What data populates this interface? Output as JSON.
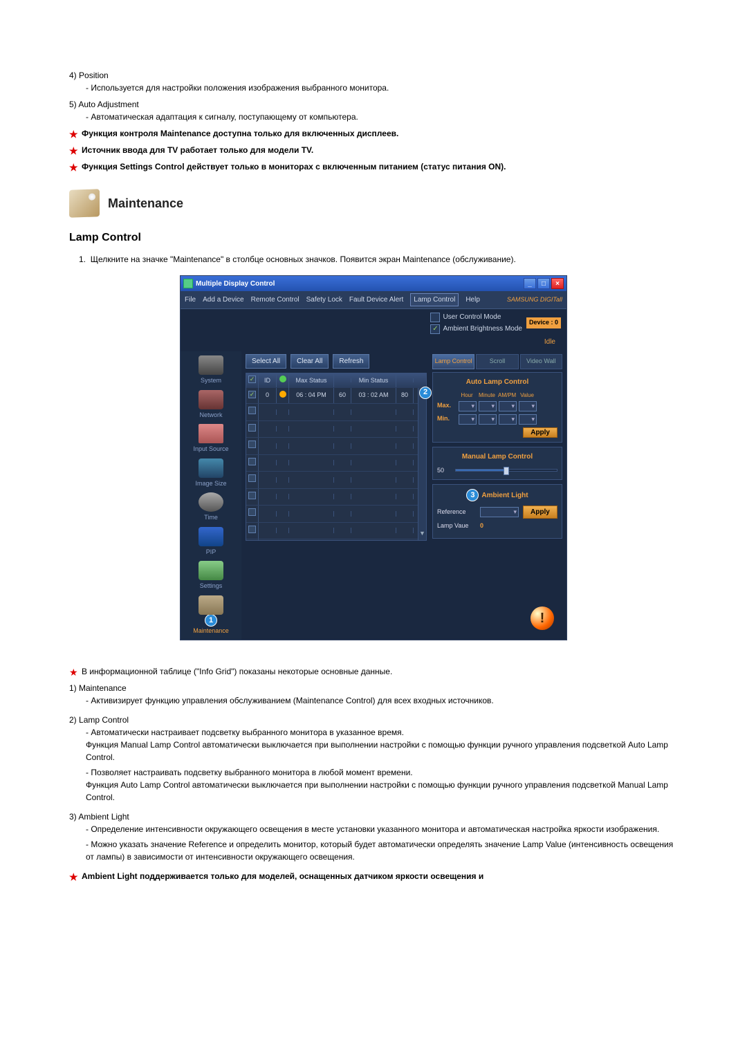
{
  "intro_items": [
    {
      "num": "4)",
      "label": "Position",
      "sub": [
        "- Используется для настройки положения изображения выбранного монитора."
      ]
    },
    {
      "num": "5)",
      "label": "Auto Adjustment",
      "sub": [
        "- Автоматическая адаптация к сигналу, поступающему от компьютера."
      ]
    }
  ],
  "intro_stars": [
    "Функция контроля Maintenance доступна только для включенных дисплеев.",
    "Источник ввода для TV работает только для модели TV.",
    "Функция Settings Control действует только в мониторах с включенным питанием (статус питания ON)."
  ],
  "section_title": "Maintenance",
  "subsection_title": "Lamp Control",
  "steps": [
    "Щелкните на значке \"Maintenance\" в столбце основных значков. Появится экран Maintenance (обслуживание)."
  ],
  "app": {
    "title": "Multiple Display Control",
    "menu": [
      "File",
      "Add a Device",
      "Remote Control",
      "Safety Lock",
      "Fault Device Alert",
      "Lamp Control",
      "Help"
    ],
    "brand": "SAMSUNG DIGITall",
    "modes": {
      "user": "User Control Mode",
      "ambient": "Ambient Brightness Mode"
    },
    "device_badge": "Device : 0",
    "idle": "Idle",
    "sidebar": [
      "System",
      "Network",
      "Input Source",
      "Image Size",
      "Time",
      "PIP",
      "Settings",
      "Maintenance"
    ],
    "callout1": "1",
    "buttons": {
      "select_all": "Select All",
      "clear_all": "Clear All",
      "refresh": "Refresh"
    },
    "grid_head": {
      "id": "ID",
      "max": "Max Status",
      "min": "Min Status"
    },
    "grid_rows": [
      {
        "checked": true,
        "id": "0",
        "max": "06 : 04  PM",
        "maxv": "60",
        "min": "03 : 02  AM",
        "minv": "80"
      }
    ],
    "tabs": {
      "lamp": "Lamp Control",
      "scroll": "Scroll",
      "video": "Video Wall"
    },
    "auto_lamp": {
      "title": "Auto Lamp Control",
      "cols": [
        "Hour",
        "Minute",
        "AM/PM",
        "Value"
      ],
      "max": "Max.",
      "min": "Min.",
      "apply": "Apply"
    },
    "manual_lamp": {
      "title": "Manual Lamp Control",
      "value": "50"
    },
    "ambient_light": {
      "title": "Ambient Light",
      "callout": "3",
      "callout2": "2",
      "reference": "Reference",
      "lamp_value_label": "Lamp Vaue",
      "lamp_value": "0",
      "apply": "Apply"
    }
  },
  "post_star1": "В информационной таблице (\"Info Grid\") показаны некоторые основные данные.",
  "post_items": [
    {
      "num": "1)",
      "label": "Maintenance",
      "sub": [
        "- Активизирует функцию управления обслуживанием (Maintenance Control) для всех входных источников."
      ]
    },
    {
      "num": "2)",
      "label": "Lamp Control",
      "sub": [
        "- Автоматически настраивает подсветку выбранного монитора в указанное время.\nФункция Manual Lamp Control автоматически выключается при выполнении настройки с помощью функции ручного управления подсветкой Auto Lamp Control.",
        "- Позволяет настраивать подсветку выбранного монитора в любой момент времени.\nФункция Auto Lamp Control автоматически выключается при выполнении настройки с помощью функции ручного управления подсветкой Manual Lamp Control."
      ]
    },
    {
      "num": "3)",
      "label": "Ambient Light",
      "sub": [
        "- Определение интенсивности окружающего освещения в месте установки указанного монитора и автоматическая настройка яркости изображения.",
        "- Можно указать значение Reference и определить монитор, который будет автоматически определять значение Lamp Value (интенсивность освещения от лампы) в зависимости от интенсивности окружающего освещения."
      ]
    }
  ],
  "post_star2": "Ambient Light поддерживается только для моделей, оснащенных датчиком яркости освещения и"
}
